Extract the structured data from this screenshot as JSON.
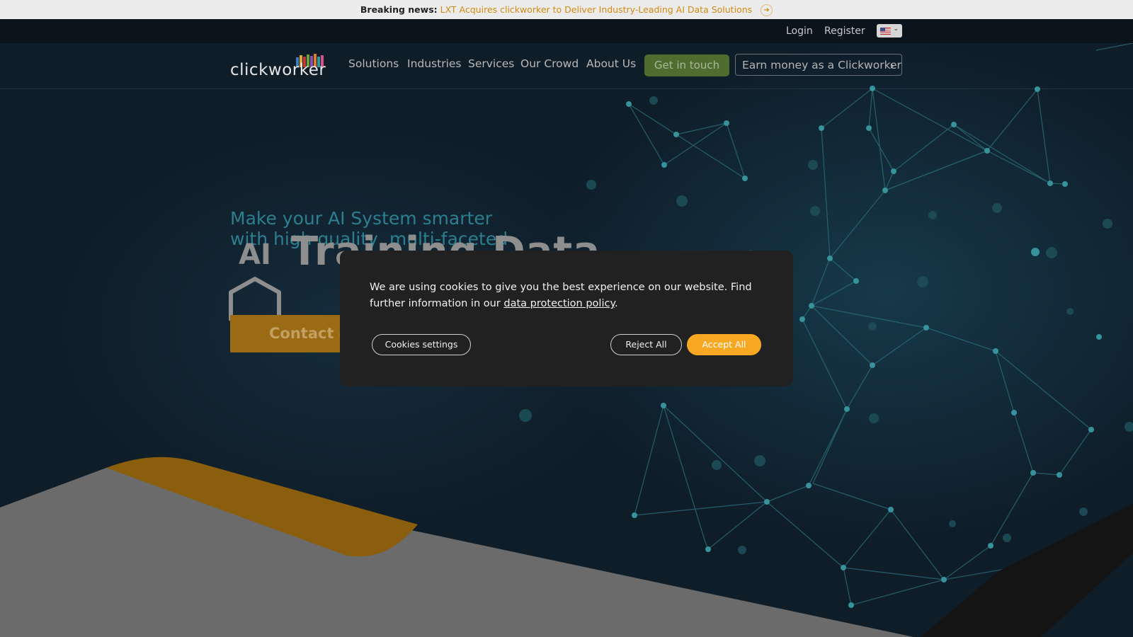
{
  "news": {
    "label": "Breaking news:",
    "link_text": "LXT Acquires clickworker to Deliver Industry-Leading AI Data Solutions"
  },
  "topbar": {
    "login": "Login",
    "register": "Register",
    "language_icon": "us-flag-icon"
  },
  "nav": {
    "logo_text": "clickworker",
    "items": [
      "Solutions",
      "Industries",
      "Services",
      "Our Crowd",
      "About Us"
    ],
    "get_in_touch": "Get in touch",
    "earn_money": "Earn money as a Clickworker"
  },
  "hero": {
    "subtitle_line1": "Make your AI System smarter",
    "subtitle_line2": "with high quality, multi-faceted",
    "ai_badge": "AI",
    "title": "Training Data",
    "contact_button": "Contact our"
  },
  "cookie": {
    "text_before": "We are using cookies to give you the best experience on our website. Find further information in our ",
    "link_text": "data protection policy",
    "text_after": ".",
    "settings_button": "Cookies settings",
    "reject_button": "Reject All",
    "accept_button": "Accept All"
  },
  "colors": {
    "accent_orange": "#f7a823",
    "news_link": "#d28a10",
    "get_in_touch_green": "#506d2f",
    "subtitle_teal": "#2c7f8f"
  }
}
